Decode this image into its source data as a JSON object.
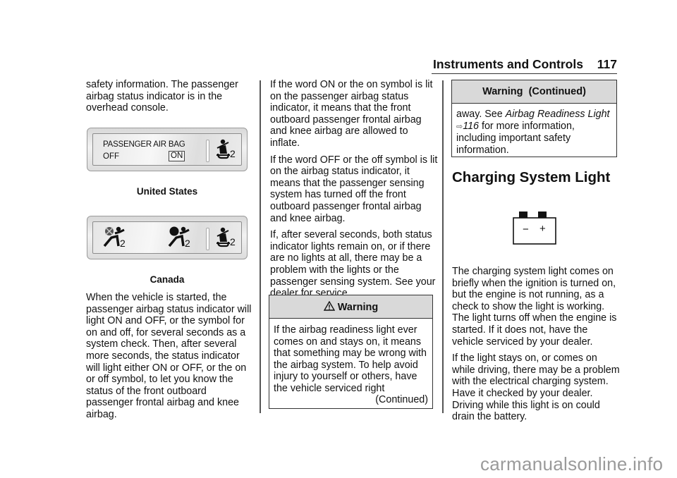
{
  "header": {
    "section_title": "Instruments and Controls",
    "page_number": "117"
  },
  "column1": {
    "intro_paragraph": "safety information. The passenger airbag status indicator is in the overhead console.",
    "figure_us": {
      "label_line1": "PASSENGER AIR BAG",
      "label_off": "OFF",
      "label_on": "ON",
      "seat_icon_suffix": "2",
      "caption": "United States"
    },
    "figure_canada": {
      "icon1_suffix": "2",
      "icon2_suffix": "2",
      "icon3_suffix": "2",
      "caption": "Canada"
    },
    "paragraph2": "When the vehicle is started, the passenger airbag status indicator will light ON and OFF, or the symbol for on and off, for several seconds as a system check. Then, after several more seconds, the status indicator will light either ON or OFF, or the on or off symbol, to let you know the status of the front outboard passenger frontal airbag and knee airbag."
  },
  "column2": {
    "paragraphs": [
      "If the word ON or the on symbol is lit on the passenger airbag status indicator, it means that the front outboard passenger frontal airbag and knee airbag are allowed to inflate.",
      "If the word OFF or the off symbol is lit on the airbag status indicator, it means that the passenger sensing system has turned off the front outboard passenger frontal airbag and knee airbag.",
      "If, after several seconds, both status indicator lights remain on, or if there are no lights at all, there may be a problem with the lights or the passenger sensing system. See your dealer for service."
    ],
    "warning": {
      "title": "Warning",
      "icon": "warning-triangle-icon",
      "body": "If the airbag readiness light ever comes on and stays on, it means that something may be wrong with the airbag system. To help avoid injury to yourself or others, have the vehicle serviced right",
      "continued": "(Continued)"
    }
  },
  "column3": {
    "warning_continued": {
      "title": "Warning  (Continued)",
      "body_prefix": "away. See ",
      "link_text": "Airbag Readiness Light",
      "xref_icon": "⇨",
      "link_page": "116",
      "body_suffix": " for more information, including important safety information."
    },
    "section_heading": "Charging System Light",
    "battery_icon": {
      "minus": "−",
      "plus": "+"
    },
    "paragraphs": [
      "The charging system light comes on briefly when the ignition is turned on, but the engine is not running, as a check to show the light is working. The light turns off when the engine is started. If it does not, have the vehicle serviced by your dealer.",
      "If the light stays on, or comes on while driving, there may be a problem with the electrical charging system. Have it checked by your dealer. Driving while this light is on could drain the battery."
    ]
  },
  "watermark": "carmanualsonline.info"
}
